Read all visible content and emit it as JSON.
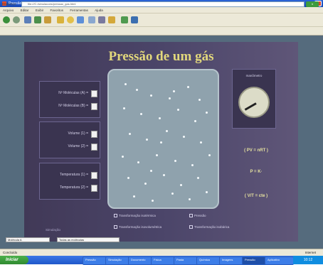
{
  "window": {
    "title": "Pressão - Microsoft Internet Explorer",
    "close": "×"
  },
  "menu": [
    "Arquivo",
    "Editar",
    "Exibir",
    "Favoritos",
    "Ferramentas",
    "Ajuda"
  ],
  "address": {
    "label": "Endereço",
    "url": "file:///C:/simulacoes/pressao_gas.html",
    "go": "Ir"
  },
  "applet": {
    "title": "Pressão de um gás",
    "left_panels": {
      "molecules": [
        "Nº Moléculas (A) =",
        "Nº Moléculas (B) ="
      ],
      "volume": [
        "Volume (1) =",
        "Volume (2) ="
      ],
      "temperature": [
        "Temperatura (1) =",
        "Temperatura (2) ="
      ]
    },
    "gauge_label": "manômetro",
    "formulas": [
      "( PV = nRT )",
      "P = K·",
      "( V/T = cte )"
    ],
    "options": [
      "Transformação isotérmica",
      "Transformação isovolumétrica",
      "Pressão",
      "Transformação isobárica"
    ],
    "footer": "Simulação"
  },
  "controls": {
    "select1": "Molécula A",
    "select2": "Todas as moléculas"
  },
  "status": {
    "left": "Concluído",
    "right": "Internet"
  },
  "taskbar": {
    "start": "Iniciar",
    "tasks": [
      "Pressão",
      "Simulação",
      "Documento",
      "Física",
      "Pasta",
      "Química",
      "Imagens",
      "Pressão",
      "Aplicativo"
    ],
    "clock": "10:12"
  }
}
